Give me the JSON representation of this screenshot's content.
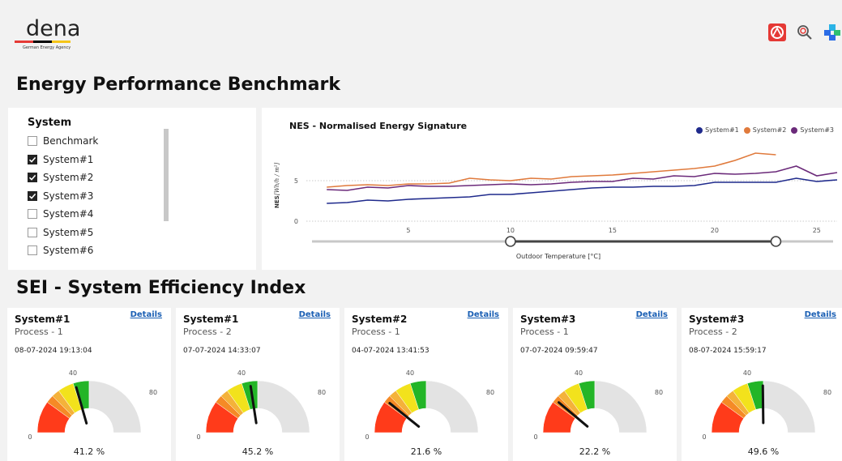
{
  "logo": {
    "word": "dena",
    "subtitle": "German Energy Agency",
    "stripe_colors": [
      "#e53935",
      "#000000",
      "#f5c518"
    ]
  },
  "toolbar": {
    "icons": [
      "app-logo-icon",
      "search-analytics-icon",
      "puzzle-icon"
    ],
    "colors": {
      "app_logo_bg": "#e53935"
    }
  },
  "page": {
    "title": "Energy Performance Benchmark"
  },
  "slicer": {
    "title": "System",
    "items": [
      {
        "label": "Benchmark",
        "checked": false
      },
      {
        "label": "System#1",
        "checked": true
      },
      {
        "label": "System#2",
        "checked": true
      },
      {
        "label": "System#3",
        "checked": true
      },
      {
        "label": "System#4",
        "checked": false
      },
      {
        "label": "System#5",
        "checked": false
      },
      {
        "label": "System#6",
        "checked": false
      }
    ]
  },
  "nes_chart": {
    "title": "NES - Normalised Energy Signature",
    "ylabel": "NES",
    "yunit": "[Wh/h / m²]",
    "xlabel": "Outdoor Temperature [°C]",
    "range_slider": {
      "min": 10,
      "max": 23
    }
  },
  "chart_data": {
    "type": "line",
    "title": "NES - Normalised Energy Signature",
    "xlabel": "Outdoor Temperature [°C]",
    "ylabel": "NES",
    "x": [
      1,
      2,
      3,
      4,
      5,
      6,
      7,
      8,
      9,
      10,
      11,
      12,
      13,
      14,
      15,
      16,
      17,
      18,
      19,
      20,
      21,
      22,
      23,
      24,
      25,
      26
    ],
    "xlim": [
      0,
      26
    ],
    "ylim": [
      0,
      10
    ],
    "xticks": [
      5,
      10,
      15,
      20,
      25
    ],
    "yticks": [
      0,
      5
    ],
    "legend_position": "top-right",
    "series": [
      {
        "name": "System#1",
        "color": "#1f2a8c",
        "values": [
          2.2,
          2.3,
          2.6,
          2.5,
          2.7,
          2.8,
          2.9,
          3.0,
          3.3,
          3.3,
          3.5,
          3.7,
          3.9,
          4.1,
          4.2,
          4.2,
          4.3,
          4.3,
          4.4,
          4.8,
          4.8,
          4.8,
          4.8,
          5.3,
          4.9,
          5.1
        ]
      },
      {
        "name": "System#2",
        "color": "#e07a3c",
        "values": [
          4.2,
          4.4,
          4.5,
          4.4,
          4.6,
          4.6,
          4.7,
          5.3,
          5.1,
          5.0,
          5.3,
          5.2,
          5.5,
          5.6,
          5.7,
          5.9,
          6.1,
          6.3,
          6.5,
          6.8,
          7.5,
          8.4,
          8.2,
          null,
          null,
          null
        ]
      },
      {
        "name": "System#3",
        "color": "#6b2a7a",
        "values": [
          3.9,
          3.8,
          4.2,
          4.1,
          4.4,
          4.3,
          4.3,
          4.4,
          4.5,
          4.6,
          4.5,
          4.6,
          4.8,
          4.9,
          4.9,
          5.3,
          5.2,
          5.6,
          5.5,
          5.9,
          5.8,
          5.9,
          6.1,
          6.8,
          5.6,
          6.0
        ]
      }
    ]
  },
  "sei": {
    "title": "SEI - System Efficiency Index"
  },
  "cards": [
    {
      "system": "System#1",
      "process": "Process - 1",
      "timestamp": "08-07-2024 19:13:04",
      "value": 41.2,
      "value_label": "41.2 %",
      "details": "Details"
    },
    {
      "system": "System#1",
      "process": "Process  - 2",
      "timestamp": "07-07-2024 14:33:07",
      "value": 45.2,
      "value_label": "45.2 %",
      "details": "Details"
    },
    {
      "system": "System#2",
      "process": "Process - 1",
      "timestamp": "04-07-2024 13:41:53",
      "value": 21.6,
      "value_label": "21.6 %",
      "details": "Details"
    },
    {
      "system": "System#3",
      "process": "Process - 1",
      "timestamp": "07-07-2024 09:59:47",
      "value": 22.2,
      "value_label": "22.2 %",
      "details": "Details"
    },
    {
      "system": "System#3",
      "process": "Process  - 2",
      "timestamp": "08-07-2024 15:59:17",
      "value": 49.6,
      "value_label": "49.6 %",
      "details": "Details"
    }
  ],
  "gauge": {
    "min": 0,
    "max": 100,
    "labels": [
      "0",
      "40",
      "80"
    ],
    "bands": [
      {
        "from": 0,
        "to": 20,
        "color": "#ff3b1a"
      },
      {
        "from": 20,
        "to": 25,
        "color": "#f58a26"
      },
      {
        "from": 25,
        "to": 30,
        "color": "#f4b23a"
      },
      {
        "from": 30,
        "to": 40,
        "color": "#f2e21c"
      },
      {
        "from": 40,
        "to": 50,
        "color": "#23b527"
      },
      {
        "from": 50,
        "to": 100,
        "color": "#e3e3e3"
      }
    ]
  }
}
